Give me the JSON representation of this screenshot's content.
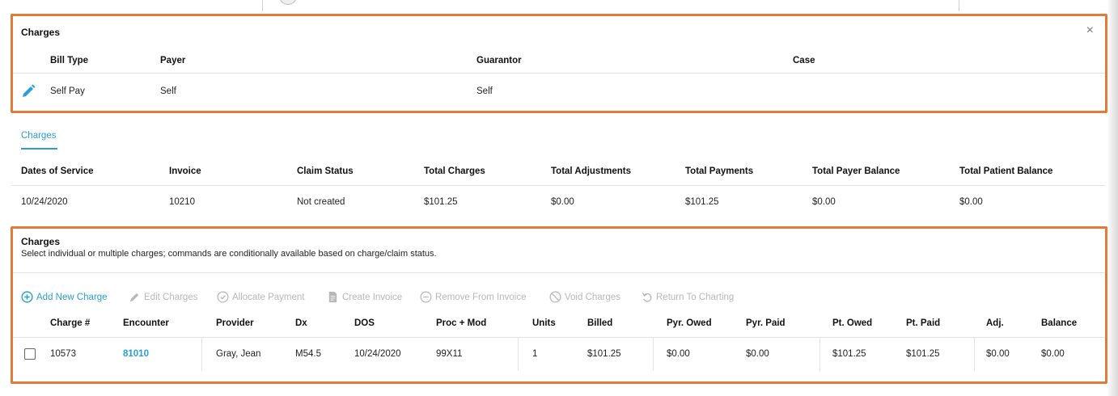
{
  "billing": {
    "title": "Charges",
    "columns": [
      "Bill Type",
      "Payer",
      "Guarantor",
      "Case"
    ],
    "row": {
      "bill_type": "Self Pay",
      "payer": "Self",
      "guarantor": "Self",
      "case": ""
    },
    "close_icon": "×"
  },
  "tabs": [
    {
      "label": "Charges",
      "active": true
    }
  ],
  "summary": {
    "columns": [
      "Dates of Service",
      "Invoice",
      "Claim Status",
      "Total Charges",
      "Total Adjustments",
      "Total Payments",
      "Total Payer Balance",
      "Total Patient Balance"
    ],
    "row": [
      "10/24/2020",
      "10210",
      "Not created",
      "$101.25",
      "$0.00",
      "$101.25",
      "$0.00",
      "$0.00"
    ]
  },
  "charges": {
    "title": "Charges",
    "description": "Select individual or multiple charges; commands are conditionally available based on charge/claim status.",
    "toolbar": [
      {
        "label": "Add New Charge",
        "icon": "plus-circle-icon",
        "enabled": true
      },
      {
        "label": "Edit Charges",
        "icon": "pencil-icon",
        "enabled": false
      },
      {
        "label": "Allocate Payment",
        "icon": "check-circle-icon",
        "enabled": false
      },
      {
        "label": "Create Invoice",
        "icon": "document-icon",
        "enabled": false
      },
      {
        "label": "Remove From Invoice",
        "icon": "minus-circle-icon",
        "enabled": false
      },
      {
        "label": "Void Charges",
        "icon": "ban-icon",
        "enabled": false
      },
      {
        "label": "Return To Charting",
        "icon": "undo-icon",
        "enabled": false
      }
    ],
    "columns": [
      "Charge #",
      "Encounter",
      "Provider",
      "Dx",
      "DOS",
      "Proc + Mod",
      "Units",
      "Billed",
      "Pyr. Owed",
      "Pyr. Paid",
      "Pt. Owed",
      "Pt. Paid",
      "Adj.",
      "Balance"
    ],
    "rows": [
      {
        "charge_num": "10573",
        "encounter": "81010",
        "provider": "Gray, Jean",
        "dx": "M54.5",
        "dos": "10/24/2020",
        "proc_mod": "99X11",
        "units": "1",
        "billed": "$101.25",
        "pyr_owed": "$0.00",
        "pyr_paid": "$0.00",
        "pt_owed": "$101.25",
        "pt_paid": "$101.25",
        "adj": "$0.00",
        "balance": "$0.00"
      }
    ]
  },
  "colors": {
    "accent": "#2a9fd6",
    "highlight": "#e07b39",
    "disabled": "#b7b7b7"
  }
}
